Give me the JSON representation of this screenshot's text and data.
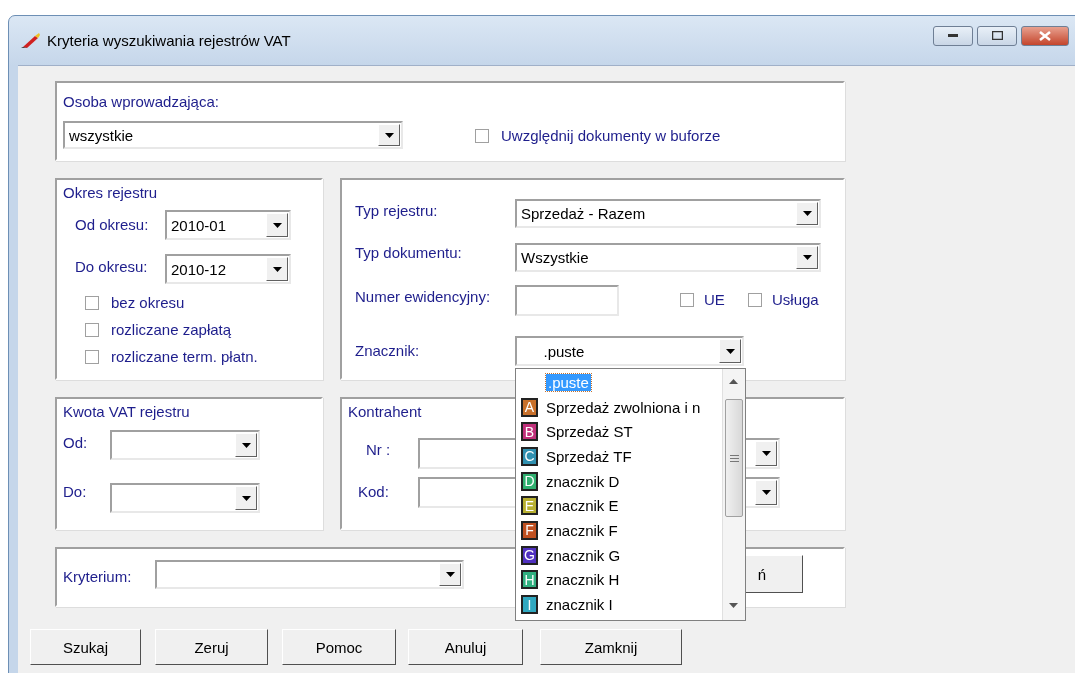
{
  "window": {
    "title": "Kryteria wyszukiwania rejestrów VAT"
  },
  "person": {
    "label": "Osoba wprowadzająca:",
    "value": "wszystkie",
    "buffer_checkbox": {
      "label": "Uwzględnij dokumenty w buforze",
      "checked": false
    }
  },
  "period": {
    "title": "Okres rejestru",
    "from_label": "Od okresu:",
    "from_value": "2010-01",
    "to_label": "Do okresu:",
    "to_value": "2010-12",
    "options": [
      {
        "label": "bez okresu",
        "checked": false
      },
      {
        "label": "rozliczane zapłatą",
        "checked": false
      },
      {
        "label": "rozliczane term. płatn.",
        "checked": false
      }
    ]
  },
  "register": {
    "type_label": "Typ rejestru:",
    "type_value": "Sprzedaż - Razem",
    "doc_label": "Typ dokumentu:",
    "doc_value": "Wszystkie",
    "number_label": "Numer ewidencyjny:",
    "flags": [
      {
        "label": "UE",
        "checked": false
      },
      {
        "label": "Usługa",
        "checked": false
      }
    ],
    "marker_label": "Znacznik:",
    "marker_value": ".puste"
  },
  "marker_list": [
    {
      "label": ".puste",
      "selected": true
    },
    {
      "letter": "A",
      "label": "Sprzedaż zwolniona i n",
      "color": "#c8702a",
      "selected": false
    },
    {
      "letter": "B",
      "label": "Sprzedaż ST",
      "color": "#c0307a",
      "selected": false
    },
    {
      "letter": "C",
      "label": "Sprzedaż TF",
      "color": "#3090b0",
      "selected": false
    },
    {
      "letter": "D",
      "label": "znacznik D",
      "color": "#30b070",
      "selected": false
    },
    {
      "letter": "E",
      "label": "znacznik E",
      "color": "#b8b030",
      "selected": false
    },
    {
      "letter": "F",
      "label": "znacznik F",
      "color": "#c05020",
      "selected": false
    },
    {
      "letter": "G",
      "label": "znacznik G",
      "color": "#5030c0",
      "selected": false
    },
    {
      "letter": "H",
      "label": "znacznik H",
      "color": "#30b080",
      "selected": false
    },
    {
      "letter": "I",
      "label": "znacznik I",
      "color": "#30a8c0",
      "selected": false
    }
  ],
  "vat_amount": {
    "title": "Kwota VAT rejestru",
    "from_label": "Od:",
    "to_label": "Do:"
  },
  "contractor": {
    "title": "Kontrahent",
    "nr_label": "Nr :",
    "code_label": "Kod:"
  },
  "criterion": {
    "label": "Kryterium:",
    "hidden_button": "ń"
  },
  "buttons": [
    "Szukaj",
    "Zeruj",
    "Pomoc",
    "Anuluj",
    "Zamknij"
  ]
}
